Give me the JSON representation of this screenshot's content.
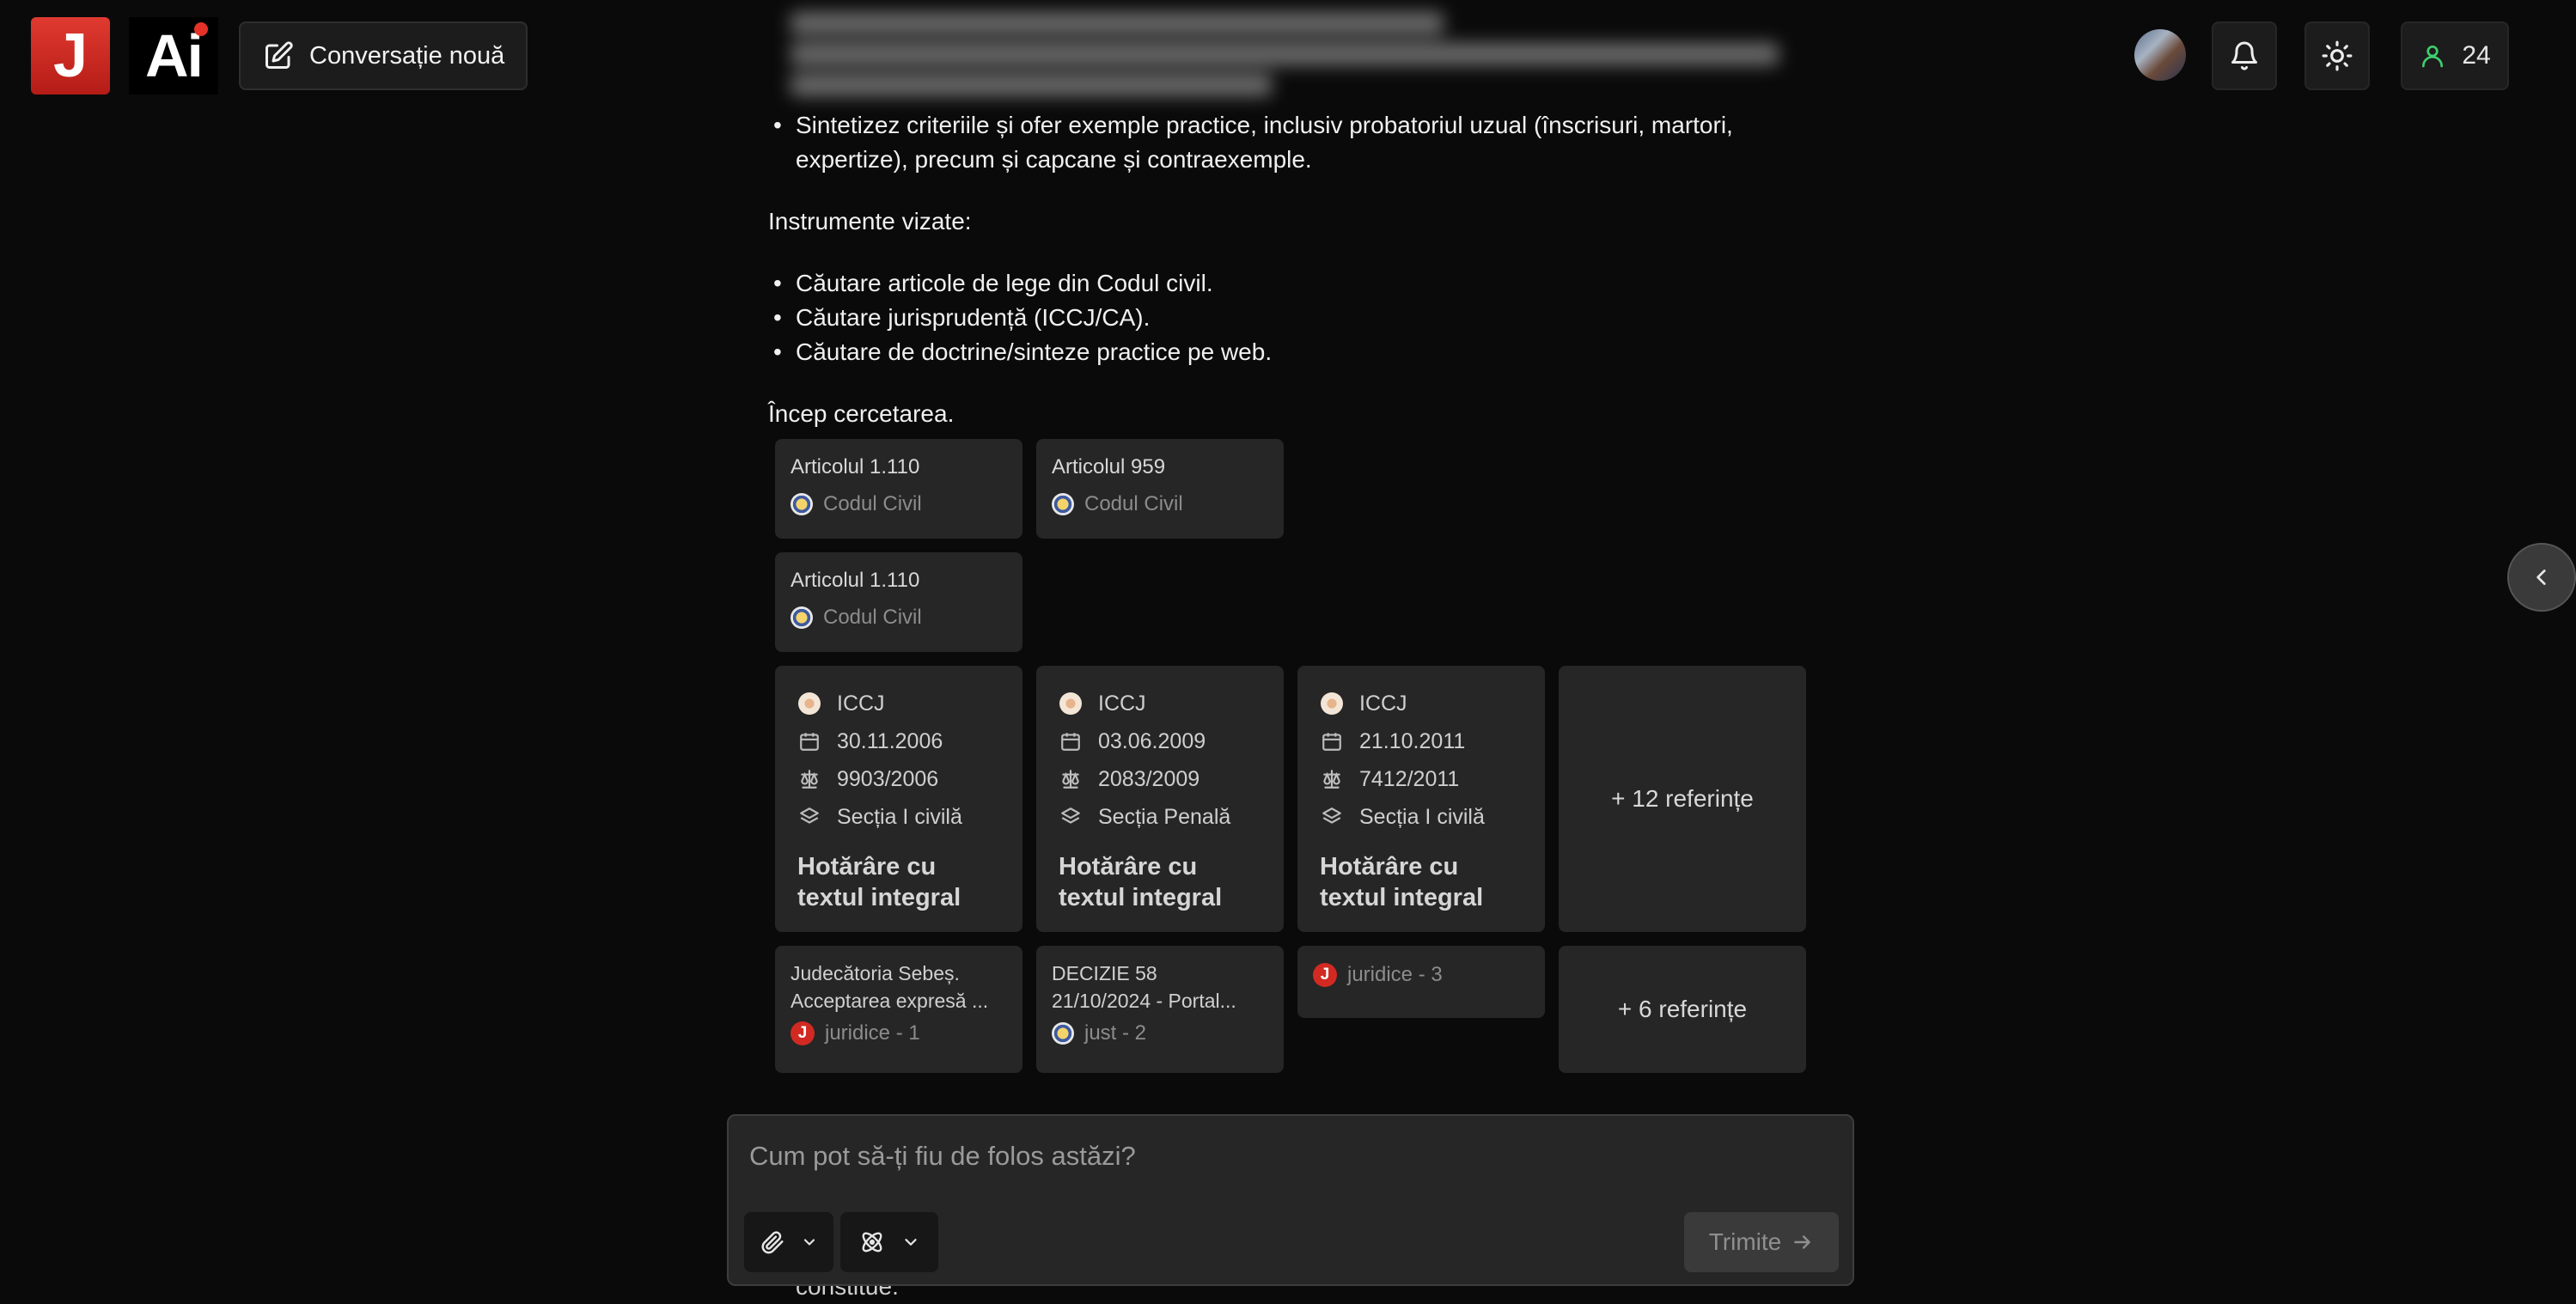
{
  "header": {
    "brand_letter": "J",
    "brand_ai": "Ai",
    "new_conversation_label": "Conversație nouă",
    "user_count": "24"
  },
  "content": {
    "bullet_top": "Sintetizez criteriile și ofer exemple practice, inclusiv probatoriul uzual (înscrisuri, martori, expertize), precum și capcane și contraexemple.",
    "tools_heading": "Instrumente vizate:",
    "tools": [
      "Căutare articole de lege din Codul civil.",
      "Căutare jurisprudență (ICCJ/CA).",
      "Căutare de doctrine/sinteze practice pe web."
    ],
    "start_text": "Încep cercetarea.",
    "peek_text": "constitue."
  },
  "law_refs": [
    {
      "title": "Articolul 1.110",
      "source": "Codul Civil"
    },
    {
      "title": "Articolul 959",
      "source": "Codul Civil"
    },
    {
      "title": "Articolul 1.110",
      "source": "Codul Civil"
    }
  ],
  "court_refs": [
    {
      "court": "ICCJ",
      "date": "30.11.2006",
      "number": "9903/2006",
      "section": "Secția I civilă",
      "doc": "Hotărâre cu textul integral"
    },
    {
      "court": "ICCJ",
      "date": "03.06.2009",
      "number": "2083/2009",
      "section": "Secția Penală",
      "doc": "Hotărâre cu textul integral"
    },
    {
      "court": "ICCJ",
      "date": "21.10.2011",
      "number": "7412/2011",
      "section": "Secția I civilă",
      "doc": "Hotărâre cu textul integral"
    }
  ],
  "court_more": "+ 12 referințe",
  "web_refs": [
    {
      "title_1": "Judecătoria Sebeș.",
      "title_2": "Acceptarea expresă ...",
      "source": "juridice - 1",
      "icon": "j-logo"
    },
    {
      "title_1": "DECIZIE 58",
      "title_2": "21/10/2024 - Portal...",
      "source": "just - 2",
      "icon": "seal"
    },
    {
      "title_1": "",
      "title_2": "",
      "source": "juridice - 3",
      "icon": "j-logo"
    }
  ],
  "web_more": "+ 6 referințe",
  "composer": {
    "placeholder": "Cum pot să-ți fiu de folos astăzi?",
    "send_label": "Trimite"
  },
  "colors": {
    "background": "#0a0a0a",
    "card": "#262626",
    "brand_red": "#d22a22",
    "user_icon_green": "#3ecf6e"
  }
}
